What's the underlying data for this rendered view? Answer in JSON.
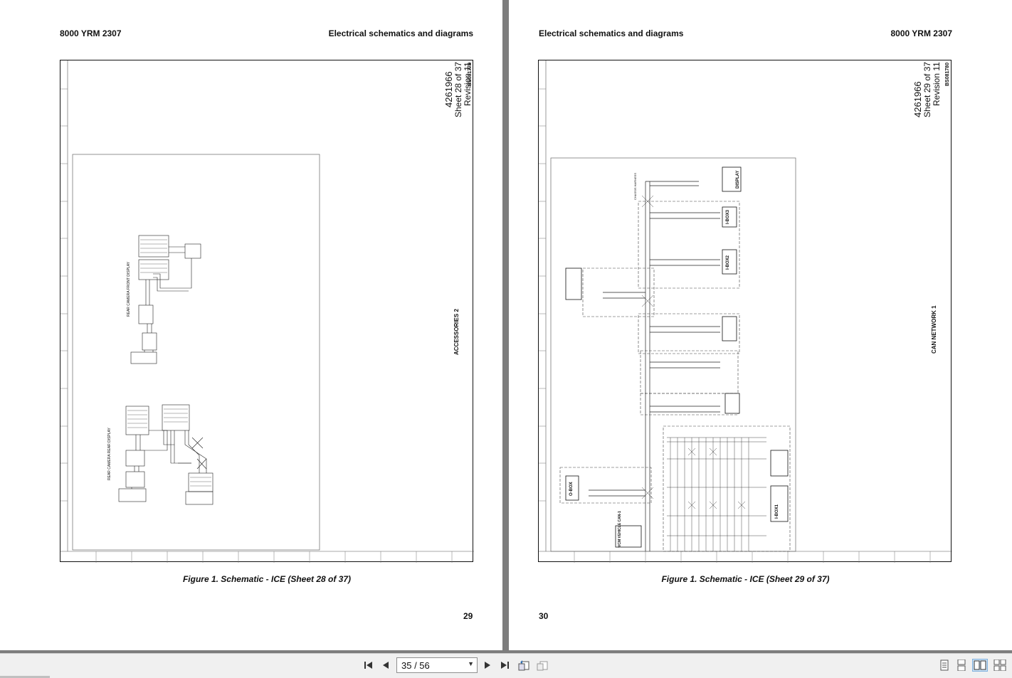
{
  "left_page": {
    "doc_code": "8000 YRM 2307",
    "section_title": "Electrical schematics and diagrams",
    "drawing_number": "4261966",
    "sheet": "Sheet 28 of 37",
    "revision": "Revision 11",
    "bs_code": "BS081779",
    "diagram_title": "ACCESSORIES 2",
    "label_front_display": "REAR CAMERA FRONT DISPLAY",
    "label_rear_display": "REAR CAMERA REAR DISPLAY",
    "caption": "Figure 1. Schematic - ICE (Sheet 28 of 37)",
    "page_number": "29"
  },
  "right_page": {
    "doc_code": "8000 YRM 2307",
    "section_title": "Electrical schematics and diagrams",
    "drawing_number": "4261966",
    "sheet": "Sheet 29 of 37",
    "revision": "Revision 11",
    "bs_code": "BS081780",
    "diagram_title": "CAN NETWORK 1",
    "label_display": "DISPLAY",
    "label_ibox3": "I-BOX3",
    "label_ibox2": "I-BOX2",
    "label_ibox1": "I-BOX1",
    "label_obox": "O-BOX",
    "label_vcm": "VCM VEHICLE CAN-1",
    "label_chassis": "CHASSIS HARNESS",
    "caption": "Figure 1. Schematic - ICE (Sheet 29 of 37)",
    "page_number": "30"
  },
  "toolbar": {
    "first_page_icon": "first-page-icon",
    "prev_page_icon": "prev-page-icon",
    "page_indicator": "35 / 56",
    "next_page_icon": "next-page-icon",
    "last_page_icon": "last-page-icon",
    "rotate_icon": "rotate-page-icon",
    "view_icons": [
      "single-page-icon",
      "continuous-page-icon",
      "two-page-icon",
      "two-page-continuous-icon"
    ]
  },
  "colors": {
    "viewer_background": "#7d7d7d",
    "page_background": "#ffffff",
    "toolbar_background": "#f0f0f0",
    "active_view_highlight": "#cde3f7"
  }
}
